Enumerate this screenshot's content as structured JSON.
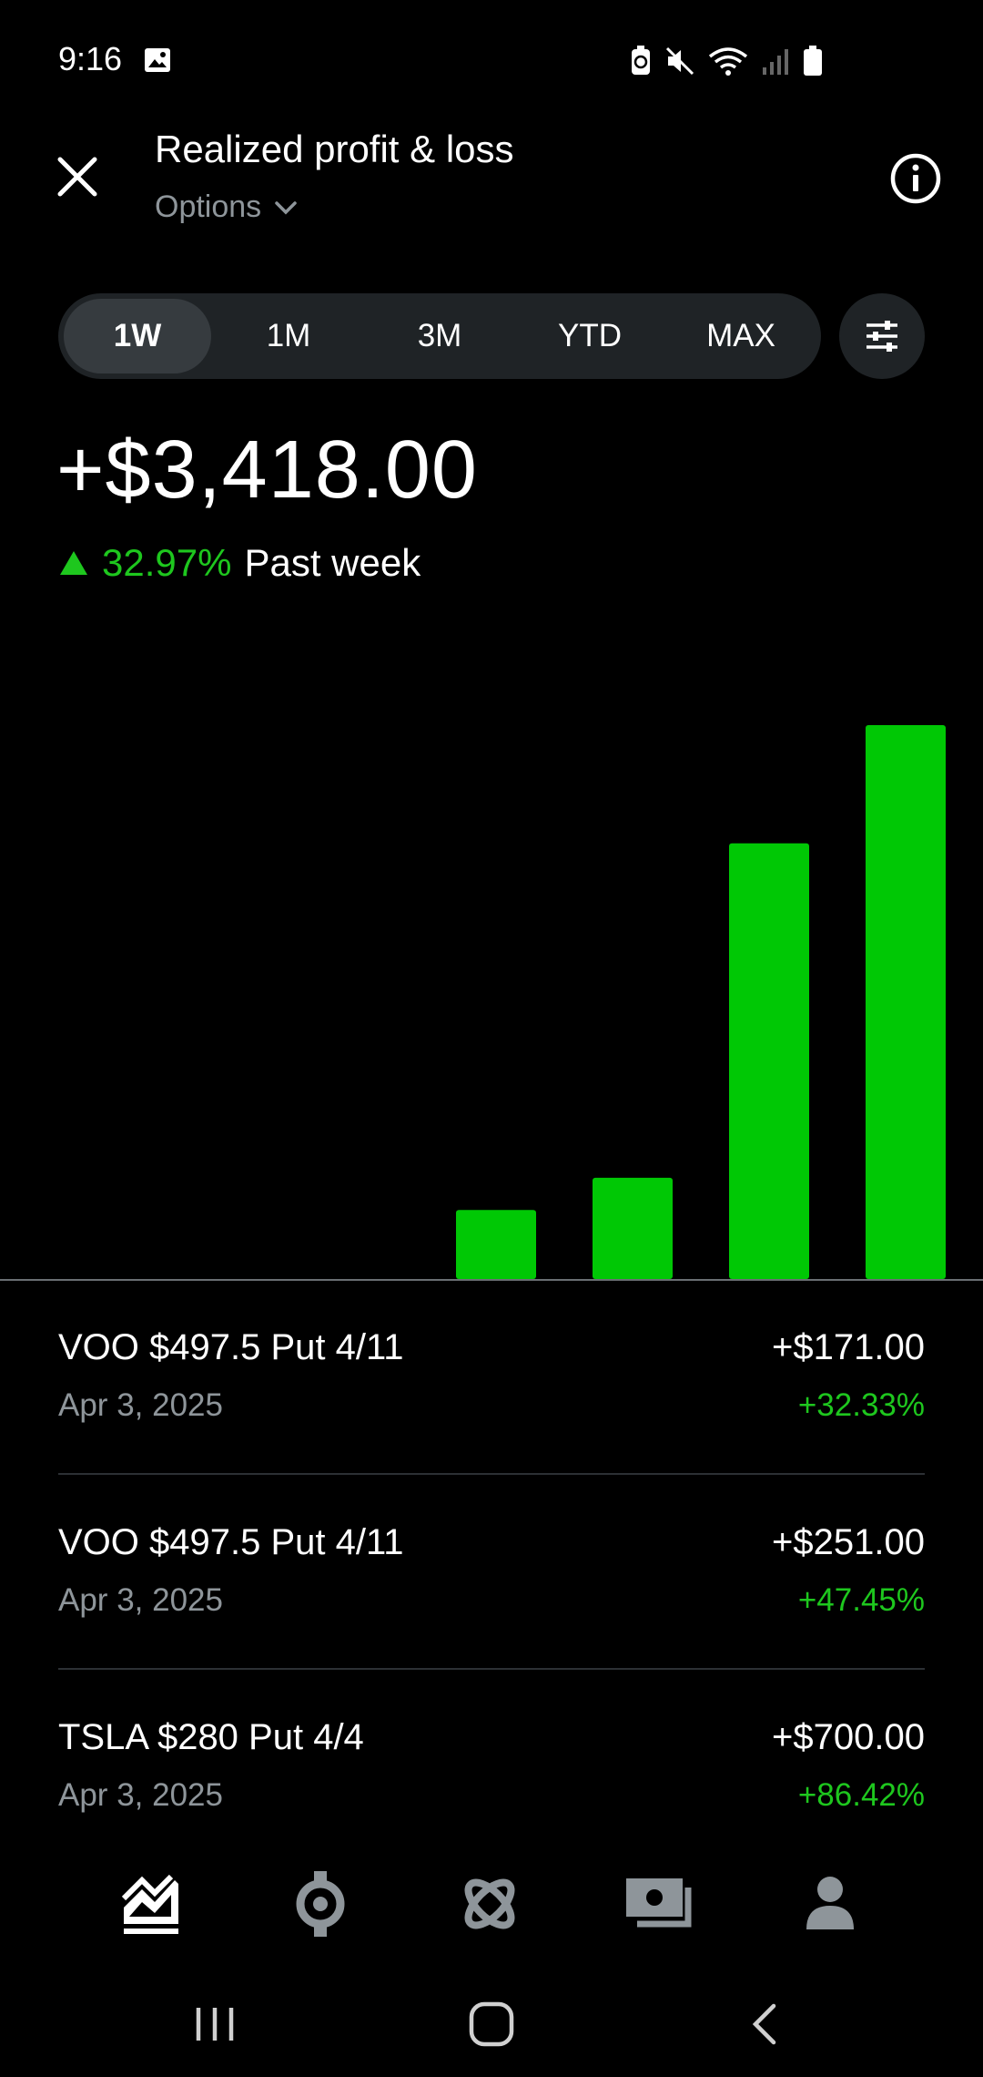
{
  "status_bar": {
    "time": "9:16",
    "icons": [
      "gallery-icon",
      "battery-saver-icon",
      "mute-icon",
      "wifi-icon",
      "signal-icon",
      "battery-icon"
    ]
  },
  "header": {
    "title": "Realized profit & loss",
    "filter_label": "Options"
  },
  "range_tabs": [
    {
      "label": "1W",
      "active": true
    },
    {
      "label": "1M",
      "active": false
    },
    {
      "label": "3M",
      "active": false
    },
    {
      "label": "YTD",
      "active": false
    },
    {
      "label": "MAX",
      "active": false
    }
  ],
  "summary": {
    "total": "+$3,418.00",
    "change_pct": "32.97%",
    "period": "Past week"
  },
  "colors": {
    "positive": "#00c805",
    "background": "#000000",
    "pill": "#1f2326",
    "secondary_text": "#8e959a"
  },
  "chart_data": {
    "type": "bar",
    "categories": [
      "",
      "",
      "",
      "",
      "",
      "",
      ""
    ],
    "values": [
      0,
      0,
      0,
      171,
      251,
      1080,
      1373
    ],
    "ylim": [
      0,
      1373
    ],
    "grid": false,
    "legend": "none"
  },
  "transactions": [
    {
      "name": "VOO $497.5 Put 4/11",
      "date": "Apr 3, 2025",
      "amount": "+$171.00",
      "pct": "+32.33%"
    },
    {
      "name": "VOO $497.5 Put 4/11",
      "date": "Apr 3, 2025",
      "amount": "+$251.00",
      "pct": "+47.45%"
    },
    {
      "name": "TSLA $280 Put 4/4",
      "date": "Apr 3, 2025",
      "amount": "+$700.00",
      "pct": "+86.42%"
    }
  ],
  "bottom_nav": [
    "investing-icon",
    "crypto-icon",
    "browse-icon",
    "cash-icon",
    "account-icon"
  ],
  "system_nav": [
    "recents-icon",
    "home-icon",
    "back-icon"
  ]
}
